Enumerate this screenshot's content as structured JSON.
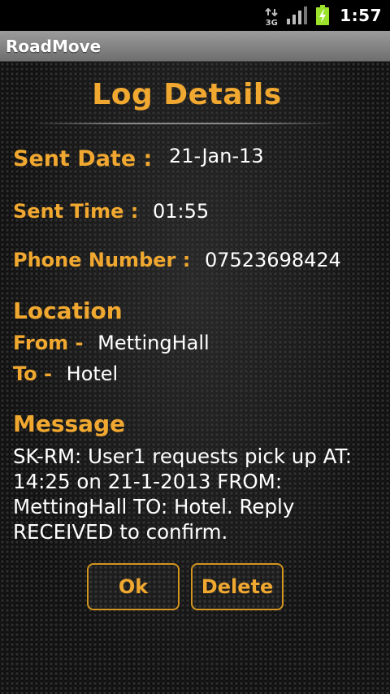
{
  "status_bar": {
    "network": "3G",
    "time": "1:57",
    "icons": [
      "3g-data-icon",
      "signal-icon",
      "battery-charging-icon"
    ]
  },
  "app": {
    "title": "RoadMove"
  },
  "colors": {
    "accent": "#f0a830",
    "text": "#ffffff",
    "title_bar": "#8a8a8a"
  },
  "page": {
    "heading": "Log Details"
  },
  "details": {
    "sent_date_label": "Sent Date :",
    "sent_date": "21-Jan-13",
    "sent_time_label": "Sent Time :",
    "sent_time": "01:55",
    "phone_label": "Phone Number :",
    "phone": "07523698424"
  },
  "location": {
    "heading": "Location",
    "from_label": "From -",
    "from": "MettingHall",
    "to_label": "To -",
    "to": "Hotel"
  },
  "message": {
    "heading": "Message",
    "body": "SK-RM: User1 requests pick up AT: 14:25 on 21-1-2013 FROM: MettingHall TO: Hotel. Reply RECEIVED to confirm."
  },
  "buttons": {
    "ok": "Ok",
    "delete": "Delete"
  }
}
